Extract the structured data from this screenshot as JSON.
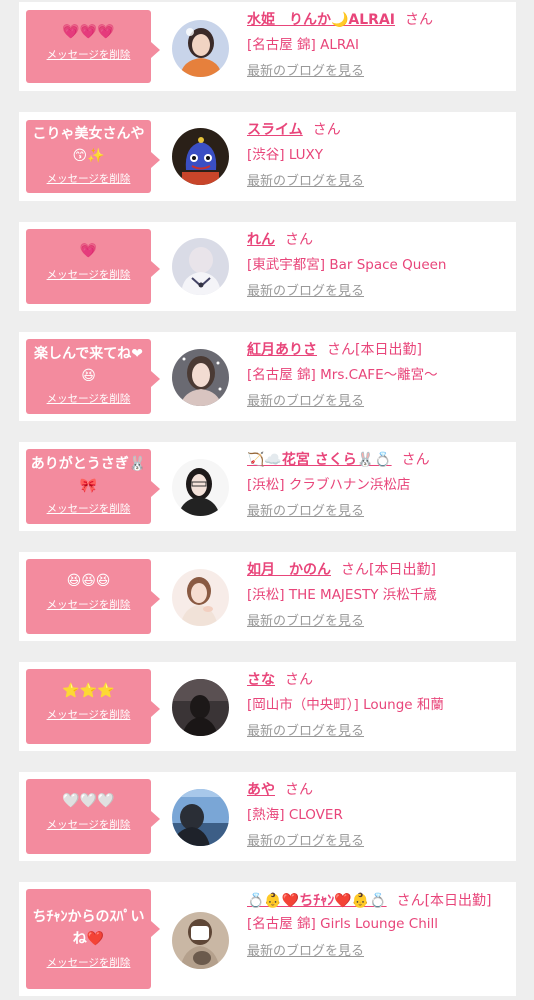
{
  "colors": {
    "bubble_bg": "#f38b9e",
    "name_pink": "#e8457a",
    "link_gray": "#999999",
    "page_bg": "#eeeeee"
  },
  "delete_label": "メッセージを削除",
  "blog_label": "最新のブログを見る",
  "items": [
    {
      "message": "💗💗💗",
      "name": "水姫　りんか🌙ALRAI",
      "honorific": "さん",
      "shop": "[名古屋 錦] ALRAI",
      "avatar_icon": "avatar-photo-icon"
    },
    {
      "message": "こりゃ美女さんや😙✨",
      "name": "スライム",
      "honorific": "さん",
      "shop": "[渋谷] LUXY",
      "avatar_icon": "avatar-photo-icon"
    },
    {
      "message": "💗",
      "name": "れん",
      "honorific": "さん",
      "shop": "[東武宇都宮] Bar Space Queen",
      "avatar_icon": "avatar-photo-icon"
    },
    {
      "message": "楽しんで来てね❤😆",
      "name": "紅月ありさ",
      "honorific": "さん[本日出勤]",
      "shop": "[名古屋 錦] Mrs.CAFE〜離宮〜",
      "avatar_icon": "avatar-photo-icon"
    },
    {
      "message": "ありがとうさぎ🐰🎀",
      "name": "🏹☁️花宮 さくら🐰💍",
      "honorific": "さん",
      "shop": "[浜松] クラブハナン浜松店",
      "avatar_icon": "avatar-photo-icon"
    },
    {
      "message": "😆😆😆",
      "name": "如月　かのん",
      "honorific": "さん[本日出勤]",
      "shop": "[浜松] THE MAJESTY 浜松千歳",
      "avatar_icon": "avatar-photo-icon"
    },
    {
      "message": "⭐⭐⭐",
      "name": "さな",
      "honorific": "さん",
      "shop": "[岡山市（中央町）] Lounge 和蘭",
      "avatar_icon": "avatar-photo-icon"
    },
    {
      "message": "🤍🤍🤍",
      "name": "あや",
      "honorific": "さん",
      "shop": "[熱海] CLOVER",
      "avatar_icon": "avatar-photo-icon"
    },
    {
      "message": "ちﾁｬﾝからのｽﾊﾟいね❤️",
      "name": "💍👶❤️ちﾁｬﾝ❤️👶💍",
      "honorific": "さん[本日出勤]",
      "shop": "[名古屋 錦] Girls Lounge Chill",
      "avatar_icon": "avatar-photo-icon"
    }
  ]
}
